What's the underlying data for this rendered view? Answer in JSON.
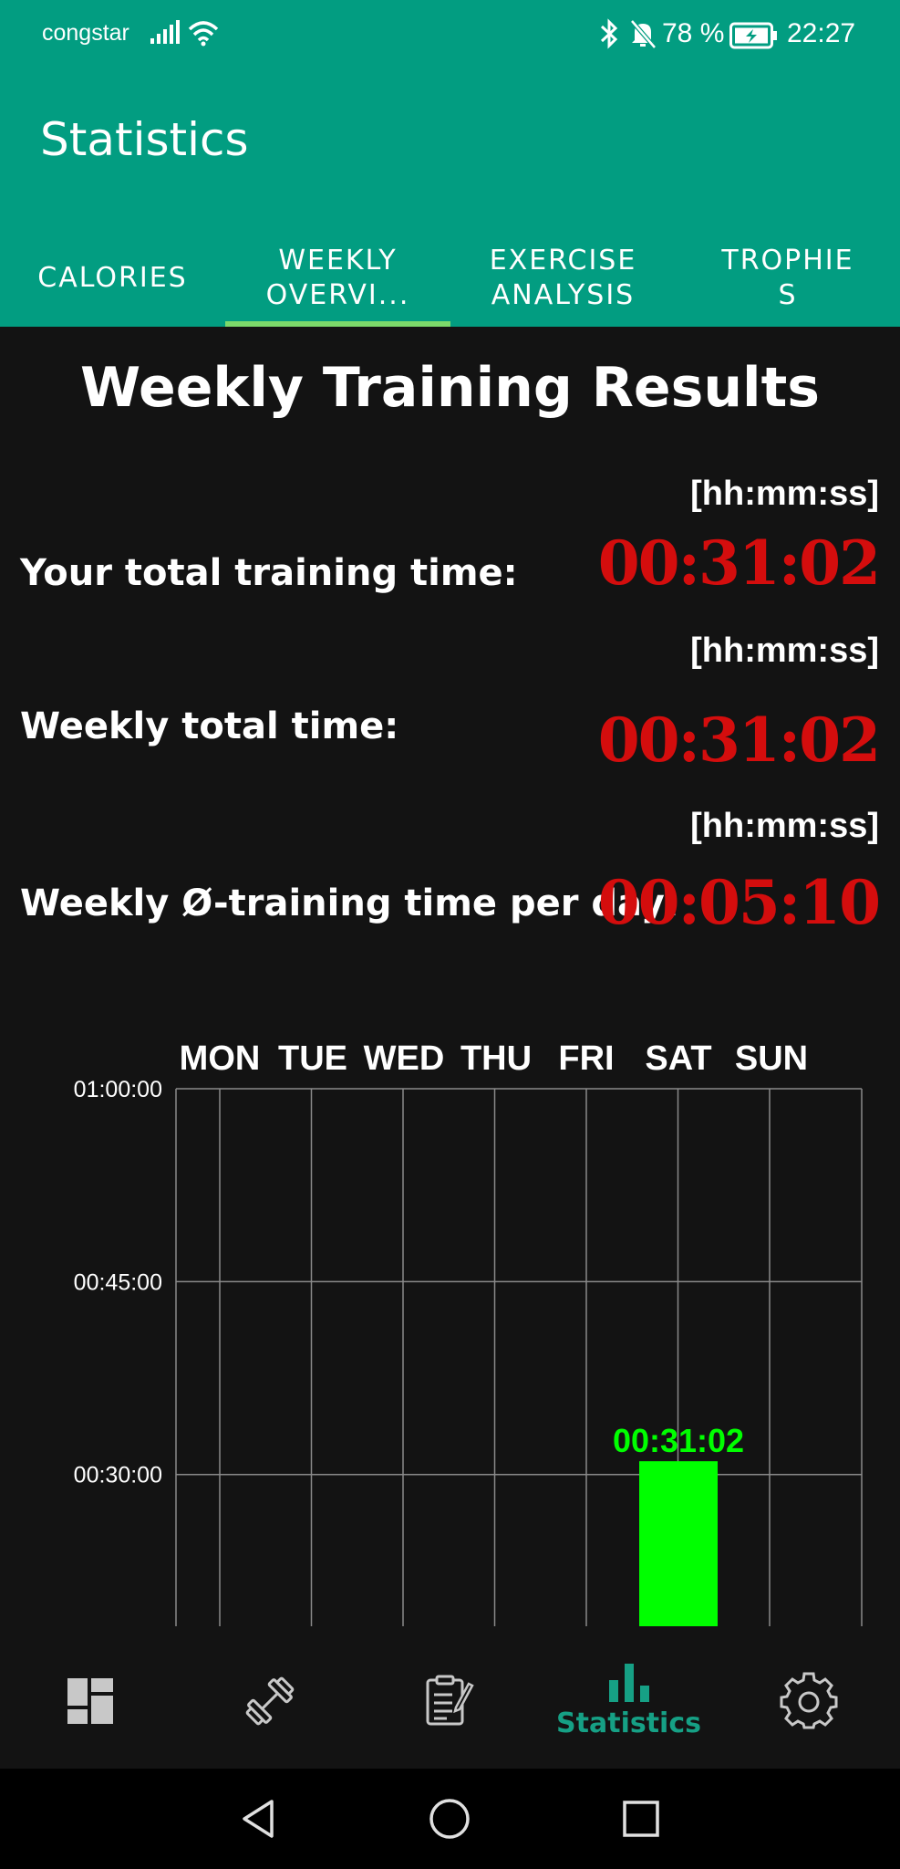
{
  "status_bar": {
    "carrier": "congstar",
    "battery_percent": "78 %",
    "time": "22:27"
  },
  "app_bar": {
    "title": "Statistics"
  },
  "tabs": [
    {
      "label": "CALORIES"
    },
    {
      "label": "WEEKLY\nOVERVI..."
    },
    {
      "label": "EXERCISE\nANALYSIS"
    },
    {
      "label": "TROPHIE\nS"
    }
  ],
  "active_tab": 1,
  "content": {
    "title": "Weekly Training Results",
    "rows": [
      {
        "unit": "[hh:mm:ss]",
        "label": "Your total training time:",
        "value": "00:31:02"
      },
      {
        "unit": "[hh:mm:ss]",
        "label": "Weekly total time:",
        "value": "00:31:02"
      },
      {
        "unit": "[hh:mm:ss]",
        "label": "Weekly Ø-training time per day:",
        "value": "00:05:10"
      }
    ]
  },
  "chart_data": {
    "type": "bar",
    "categories": [
      "MON",
      "TUE",
      "WED",
      "THU",
      "FRI",
      "SAT",
      "SUN"
    ],
    "values_minutes": [
      0,
      0,
      0,
      0,
      0,
      31.033,
      0
    ],
    "data_labels": [
      "",
      "",
      "",
      "",
      "",
      "00:31:02",
      ""
    ],
    "y_tick_labels": [
      "01:00:00",
      "00:45:00",
      "00:30:00"
    ],
    "y_ticks_minutes": [
      60,
      45,
      30
    ],
    "ylim_minutes": [
      18.2,
      60
    ],
    "grid": true,
    "bar_color": "#00ff00",
    "label_color": "#00ff00"
  },
  "bottom_nav": {
    "items": [
      {
        "icon": "dashboard-icon"
      },
      {
        "icon": "dumbbell-icon"
      },
      {
        "icon": "notes-icon"
      },
      {
        "icon": "statistics-icon",
        "label": "Statistics"
      },
      {
        "icon": "gear-icon"
      }
    ],
    "active_color": "#16a085"
  },
  "colors": {
    "primary": "#029d81",
    "background": "#131313",
    "value_red": "#d40d0d",
    "tab_indicator": "#7cd96a"
  }
}
